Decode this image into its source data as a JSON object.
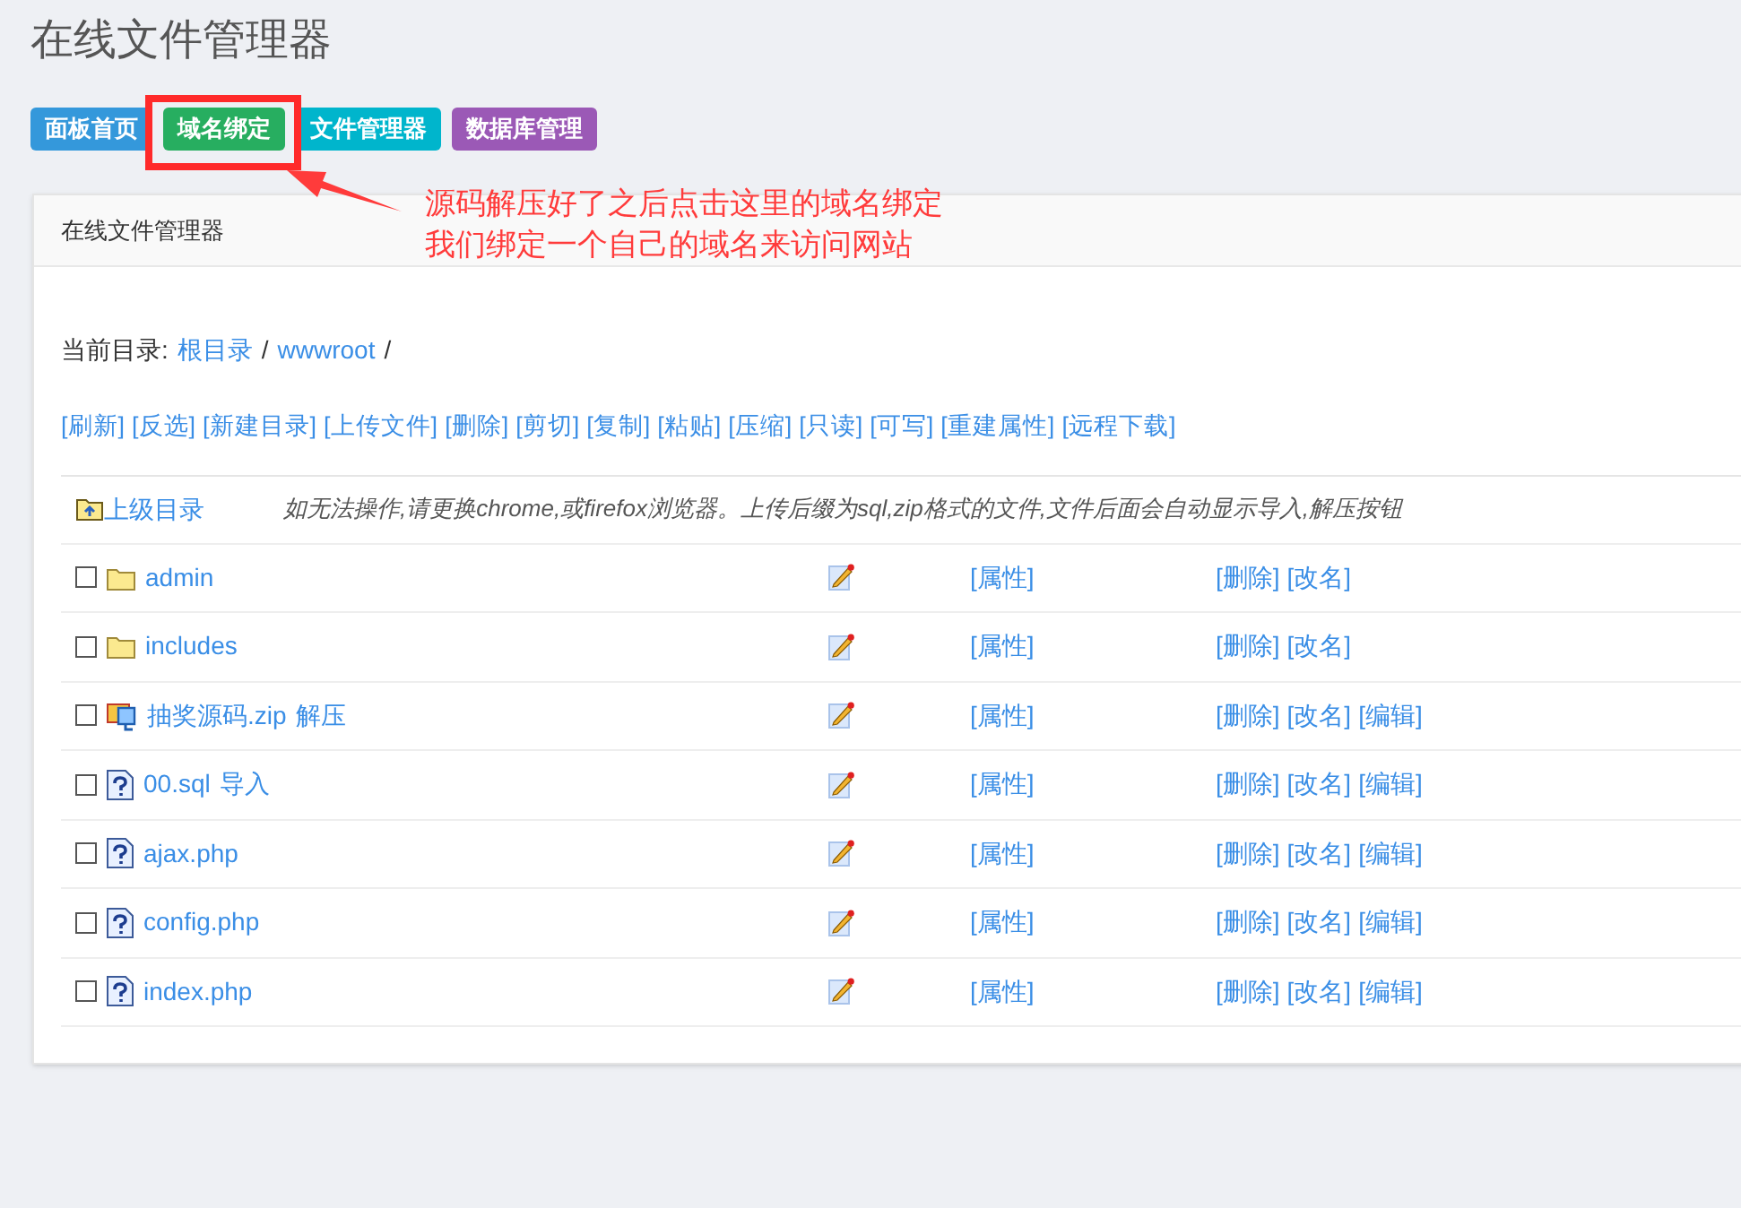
{
  "page_title": "在线文件管理器",
  "nav_buttons": [
    {
      "label": "面板首页",
      "color": "#3498db",
      "highlighted": false
    },
    {
      "label": "域名绑定",
      "color": "#27ae60",
      "highlighted": true
    },
    {
      "label": "文件管理器",
      "color": "#00b5cc",
      "highlighted": false
    },
    {
      "label": "数据库管理",
      "color": "#9b59b6",
      "highlighted": false
    }
  ],
  "annotation": {
    "lines": [
      "源码解压好了之后点击这里的域名绑定",
      "我们绑定一个自己的域名来访问网站"
    ]
  },
  "panel": {
    "title": "在线文件管理器",
    "path": {
      "label": "当前目录:",
      "parts": [
        {
          "text": "根目录",
          "kind": "link"
        },
        {
          "text": "/",
          "kind": "sep"
        },
        {
          "text": "wwwroot",
          "kind": "link"
        },
        {
          "text": "/",
          "kind": "sep"
        }
      ]
    },
    "toolbar": [
      "[刷新]",
      "[反选]",
      "[新建目录]",
      "[上传文件]",
      "[删除]",
      "[剪切]",
      "[复制]",
      "[粘贴]",
      "[压缩]",
      "[只读]",
      "[可写]",
      "[重建属性]",
      "[远程下载]"
    ],
    "parent_dir": {
      "label": "上级目录",
      "hint": "如无法操作,请更换chrome,或firefox浏览器。上传后缀为sql,zip格式的文件,文件后面会自动显示导入,解压按钮"
    },
    "files": [
      {
        "name": "admin",
        "kind": "folder",
        "checked": false,
        "properties": "[属性]",
        "ops": [
          "[删除]",
          "[改名]"
        ]
      },
      {
        "name": "includes",
        "kind": "folder",
        "checked": false,
        "properties": "[属性]",
        "ops": [
          "[删除]",
          "[改名]"
        ]
      },
      {
        "name": "抽奖源码.zip",
        "kind": "archive",
        "action": "解压",
        "checked": false,
        "properties": "[属性]",
        "ops": [
          "[删除]",
          "[改名]",
          "[编辑]"
        ]
      },
      {
        "name": "00.sql",
        "kind": "file",
        "action": "导入",
        "checked": false,
        "properties": "[属性]",
        "ops": [
          "[删除]",
          "[改名]",
          "[编辑]"
        ]
      },
      {
        "name": "ajax.php",
        "kind": "file",
        "checked": false,
        "properties": "[属性]",
        "ops": [
          "[删除]",
          "[改名]",
          "[编辑]"
        ]
      },
      {
        "name": "config.php",
        "kind": "file",
        "checked": false,
        "properties": "[属性]",
        "ops": [
          "[删除]",
          "[改名]",
          "[编辑]"
        ]
      },
      {
        "name": "index.php",
        "kind": "file",
        "checked": false,
        "properties": "[属性]",
        "ops": [
          "[删除]",
          "[改名]",
          "[编辑]"
        ]
      }
    ]
  }
}
